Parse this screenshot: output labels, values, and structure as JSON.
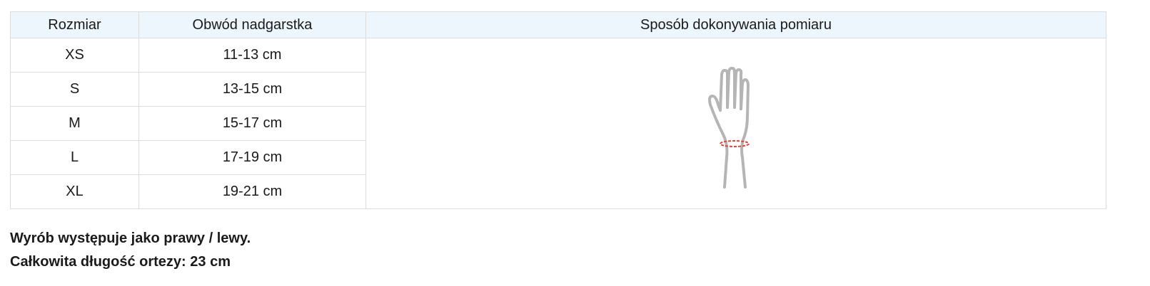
{
  "table": {
    "headers": [
      "Rozmiar",
      "Obwód nadgarstka",
      "Sposób dokonywania pomiaru"
    ],
    "rows": [
      {
        "size": "XS",
        "wrist": "11-13 cm"
      },
      {
        "size": "S",
        "wrist": "13-15 cm"
      },
      {
        "size": "M",
        "wrist": "15-17 cm"
      },
      {
        "size": "L",
        "wrist": "17-19 cm"
      },
      {
        "size": "XL",
        "wrist": "19-21 cm"
      }
    ],
    "illustration": {
      "icon": "hand-wrist-measurement-icon",
      "outline_color": "#b5b5b5",
      "measure_color": "#e0453a"
    }
  },
  "notes": {
    "line1": "Wyrób występuje jako prawy / lewy.",
    "line2": "Całkowita długość ortezy: 23 cm"
  }
}
